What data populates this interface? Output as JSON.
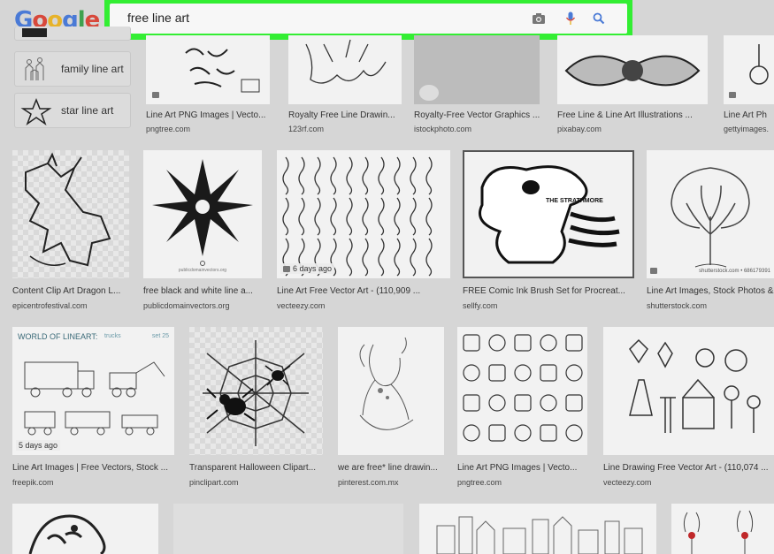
{
  "logo": {
    "letters": [
      "G",
      "o",
      "o",
      "g",
      "l",
      "e"
    ],
    "colors": [
      "#4a7ad6",
      "#d8483b",
      "#e7b32a",
      "#4a7ad6",
      "#3fa14f",
      "#d8483b"
    ]
  },
  "search": {
    "query": "free line art",
    "highlight_color": "#33ee33"
  },
  "icons": {
    "camera": "camera-icon",
    "mic": "mic-icon",
    "search": "search-icon"
  },
  "related": [
    {
      "label": "family line art"
    },
    {
      "label": "star line art"
    }
  ],
  "results": {
    "row1": [
      {
        "title": "Line Art PNG Images | Vecto...",
        "source": "pngtree.com"
      },
      {
        "title": "Royalty Free Line Drawin...",
        "source": "123rf.com"
      },
      {
        "title": "Royalty-Free Vector Graphics ...",
        "source": "istockphoto.com"
      },
      {
        "title": "Free Line & Line Art Illustrations ...",
        "source": "pixabay.com"
      },
      {
        "title": "Line Art Ph",
        "source": "gettyimages."
      }
    ],
    "row2": [
      {
        "title": "Content Clip Art Dragon L...",
        "source": "epicentrofestival.com"
      },
      {
        "title": "free black and white line a...",
        "source": "publicdomainvectors.org",
        "thumb_text": "publicdomainvectors.org"
      },
      {
        "title": "Line Art Free Vector Art - (110,909 ...",
        "source": "vecteezy.com",
        "age": "6 days ago"
      },
      {
        "title": "FREE Comic Ink Brush Set for Procreat...",
        "source": "sellfy.com",
        "thumb_text": "THE STRATHMORE"
      },
      {
        "title": "Line Art Images, Stock Photos & ...",
        "source": "shutterstock.com",
        "thumb_text": "shutterstock.com • 686179391"
      }
    ],
    "row3": [
      {
        "title": "Line Art Images | Free Vectors, Stock ...",
        "source": "freepik.com",
        "age": "5 days ago",
        "thumb_title": "WORLD OF LINEART:",
        "thumb_sub": "trucks",
        "thumb_set": "set 25"
      },
      {
        "title": "Transparent Halloween Clipart...",
        "source": "pinclipart.com"
      },
      {
        "title": "we are free* line drawin...",
        "source": "pinterest.com.mx"
      },
      {
        "title": "Line Art PNG Images | Vecto...",
        "source": "pngtree.com"
      },
      {
        "title": "Line Drawing Free Vector Art - (110,074 ...",
        "source": "vecteezy.com"
      }
    ]
  }
}
